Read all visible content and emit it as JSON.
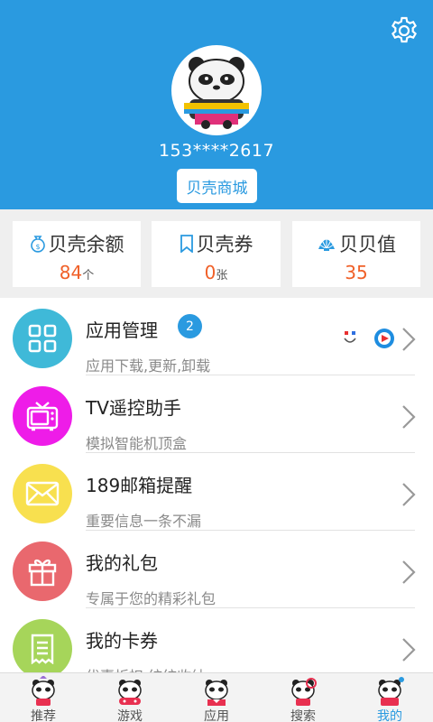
{
  "header": {
    "phone": "153****2617",
    "mall_button": "贝壳商城",
    "settings_icon": "gear-icon",
    "avatar_icon": "panda-avatar"
  },
  "stats": [
    {
      "title": "贝壳余额",
      "value": "84",
      "unit": "个",
      "icon": "money-bag-icon"
    },
    {
      "title": "贝壳券",
      "value": "0",
      "unit": "张",
      "icon": "bookmark-icon"
    },
    {
      "title": "贝贝值",
      "value": "35",
      "unit": "",
      "icon": "shell-icon"
    }
  ],
  "menu": [
    {
      "title": "应用管理",
      "subtitle": "应用下载,更新,卸载",
      "badge": "2",
      "color": "#3fb9d8",
      "icon": "apps-grid-icon"
    },
    {
      "title": "TV遥控助手",
      "subtitle": "模拟智能机顶盒",
      "color": "#ee1ce8",
      "icon": "tv-icon"
    },
    {
      "title": "189邮箱提醒",
      "subtitle": "重要信息一条不漏",
      "color": "#f8e04f",
      "icon": "mail-icon"
    },
    {
      "title": "我的礼包",
      "subtitle": "专属于您的精彩礼包",
      "color": "#e9686e",
      "icon": "gift-icon"
    },
    {
      "title": "我的卡券",
      "subtitle": "优惠折扣 统统收纳",
      "color": "#a6d55a",
      "icon": "receipt-icon"
    }
  ],
  "tabs": [
    {
      "label": "推荐",
      "active": false
    },
    {
      "label": "游戏",
      "active": false
    },
    {
      "label": "应用",
      "active": false
    },
    {
      "label": "搜索",
      "active": false
    },
    {
      "label": "我的",
      "active": true
    }
  ],
  "colors": {
    "primary": "#2a9ae0",
    "value": "#f06028"
  }
}
